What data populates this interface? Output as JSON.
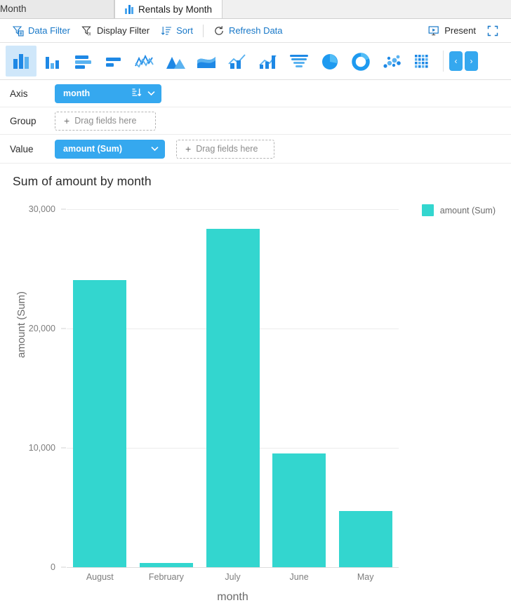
{
  "window": {
    "tabs": [
      {
        "label": "Month",
        "active": false,
        "icon": "none"
      },
      {
        "label": "Rentals by Month",
        "active": true,
        "icon": "bar-chart-icon"
      }
    ]
  },
  "toolbar": {
    "data_filter": "Data Filter",
    "display_filter": "Display Filter",
    "sort": "Sort",
    "refresh_data": "Refresh Data",
    "present": "Present",
    "fullscreen_icon": "fullscreen-icon"
  },
  "chart_types": [
    {
      "name": "column-chart",
      "selected": true
    },
    {
      "name": "column-chart-small",
      "selected": false
    },
    {
      "name": "bar-chart",
      "selected": false
    },
    {
      "name": "bar-chart-small",
      "selected": false
    },
    {
      "name": "line-chart",
      "selected": false
    },
    {
      "name": "area-chart",
      "selected": false
    },
    {
      "name": "stream-chart",
      "selected": false
    },
    {
      "name": "combo-line-column-chart",
      "selected": false
    },
    {
      "name": "combo-chart-2",
      "selected": false
    },
    {
      "name": "waterfall-chart",
      "selected": false
    },
    {
      "name": "funnel-chart",
      "selected": false
    },
    {
      "name": "pie-chart",
      "selected": false
    },
    {
      "name": "donut-chart",
      "selected": false
    },
    {
      "name": "scatter-chart",
      "selected": false
    },
    {
      "name": "heatmap-chart",
      "selected": false
    }
  ],
  "nav": {
    "prev": "‹",
    "next": "›"
  },
  "shelves": {
    "axis": {
      "label": "Axis",
      "field": "month",
      "sort_icon": "sort-descending-icon",
      "menu_icon": "chevron-down-icon"
    },
    "group": {
      "label": "Group",
      "placeholder": "Drag fields here"
    },
    "value": {
      "label": "Value",
      "field": "amount (Sum)",
      "menu_icon": "chevron-down-icon",
      "placeholder": "Drag fields here"
    }
  },
  "chart_data": {
    "type": "bar",
    "title": "Sum of amount by month",
    "categories": [
      "August",
      "February",
      "July",
      "June",
      "May"
    ],
    "values": [
      24060,
      350,
      28350,
      9530,
      4700
    ],
    "series": [
      {
        "name": "amount (Sum)",
        "values": [
          24060,
          350,
          28350,
          9530,
          4700
        ]
      }
    ],
    "xlabel": "month",
    "ylabel": "amount (Sum)",
    "ylim": [
      0,
      30000
    ],
    "yticks": [
      0,
      10000,
      20000,
      30000
    ],
    "ytick_labels": [
      "0",
      "10,000",
      "20,000",
      "30,000"
    ],
    "grid": true,
    "legend": [
      "amount (Sum)"
    ],
    "legend_position": "top-right",
    "bar_color": "#33d6cf"
  }
}
